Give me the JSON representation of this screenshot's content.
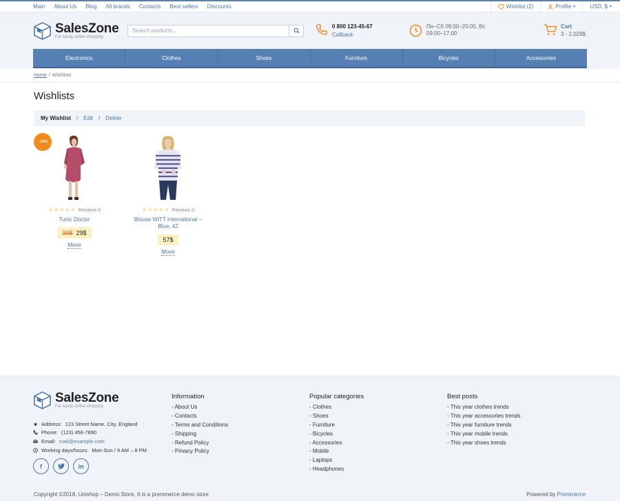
{
  "topbar": {
    "nav": [
      "Main",
      "About Us",
      "Blog",
      "All brands",
      "Contacts",
      "Best sellers",
      "Discounts"
    ],
    "wishlist": "Wishlist (2)",
    "profile": "Profile",
    "currency": "USD, $"
  },
  "header": {
    "logo_name": "SalesZone",
    "logo_tagline": "For easily online shopping",
    "search_placeholder": "Search products...",
    "phone": "0 800 123-45-67",
    "callback": "Callback",
    "hours_line1": "Пн–Сб 09:00–20:00, Вс",
    "hours_line2": "09:00–17:00",
    "cart_title": "Cart",
    "cart_summary": "3 - 2,029$"
  },
  "mainnav": [
    "Electronics",
    "Clothes",
    "Shoes",
    "Furniture",
    "Bicycles",
    "Accessories"
  ],
  "breadcrumb": {
    "home": "Home",
    "sep": "/",
    "current": "Wishlists"
  },
  "page_title": "Wishlists",
  "wishlist_bar": {
    "current": "My Wishlist",
    "sep": "/",
    "edit": "Edit",
    "delete": "Delete"
  },
  "products": [
    {
      "badge": "- 15%",
      "reviews": "Reviews 0",
      "name": "Tunic Doctor",
      "old_price": "34$",
      "price": "29$",
      "move": "Move",
      "rating": 0
    },
    {
      "badge": "",
      "reviews": "Reviews 0",
      "name": "Blouse WITT international – Blue, 42",
      "old_price": "",
      "price": "57$",
      "move": "Move",
      "rating": 0
    }
  ],
  "footer": {
    "logo_name": "SalesZone",
    "logo_tagline": "For easily online shopping",
    "address_label": "Address:",
    "address": "123 Street Name, City, England",
    "phone_label": "Phone:",
    "phone": "(123) 456-7890",
    "email_label": "Email:",
    "email": "mail@example.com",
    "hours_label": "Working days/hours:",
    "hours": "Mon-Sun / 9 AM – 8 PM",
    "socials": [
      "f",
      "t",
      "in"
    ],
    "info_title": "Information",
    "info_items": [
      "- About Us",
      "- Contacts",
      "- Terms and Conditions",
      "- Shipping",
      "- Refund Policy",
      "- Privacy Policy"
    ],
    "cat_title": "Popular categories",
    "cat_items": [
      "- Clothes",
      "- Shoes",
      "- Furniture",
      "- Bicycles",
      "- Accessories",
      "- Mobile",
      "- Laptops",
      "- Headphones"
    ],
    "posts_title": "Best posts",
    "posts_items": [
      "- This year clothes trends",
      "- This year accessories trends",
      "- This year furniture trends",
      "- This year mobile trends",
      "- This year shoes trends"
    ],
    "copyright": "Copyright ©2018, Unishop – Demo Store, It is a premmerce demo store",
    "powered_label": "Powered by",
    "powered_link": "Premmerce"
  },
  "colors": {
    "accent": "#4a76a8",
    "nav": "#5680b4",
    "orange": "#f38a1e",
    "price_bg": "#fdf1c3"
  }
}
